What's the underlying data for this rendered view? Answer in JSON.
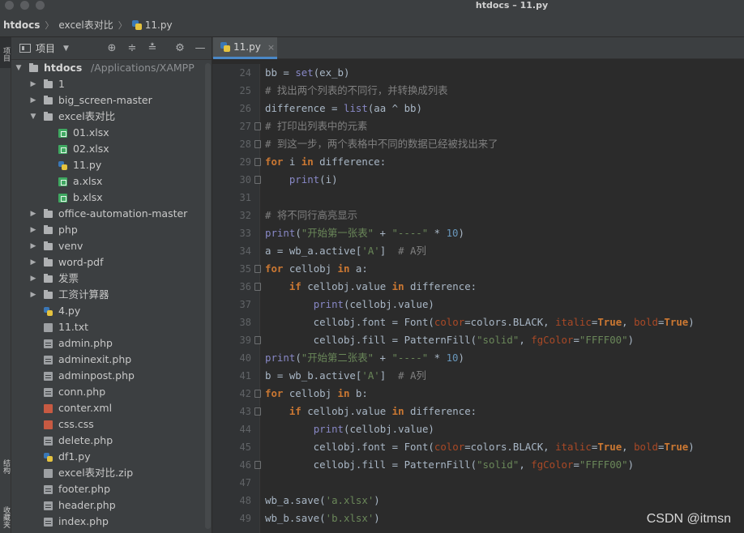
{
  "window": {
    "title": "htdocs – 11.py"
  },
  "breadcrumb": {
    "items": [
      "htdocs",
      "excel表对比",
      "11.py"
    ]
  },
  "stripe": {
    "project_tab": "项目",
    "structure_tab": "结构",
    "favorites_tab": "收藏夹"
  },
  "project": {
    "toolbar_label": "项目",
    "root": {
      "name": "htdocs",
      "path": "/Applications/XAMPP"
    },
    "items": [
      {
        "label": "1",
        "type": "folder",
        "depth": 1,
        "expanded": false
      },
      {
        "label": "big_screen-master",
        "type": "folder",
        "depth": 1,
        "expanded": false
      },
      {
        "label": "excel表对比",
        "type": "folder",
        "depth": 1,
        "expanded": true
      },
      {
        "label": "01.xlsx",
        "type": "xlsx",
        "depth": 2
      },
      {
        "label": "02.xlsx",
        "type": "xlsx",
        "depth": 2
      },
      {
        "label": "11.py",
        "type": "py",
        "depth": 2
      },
      {
        "label": "a.xlsx",
        "type": "xlsx",
        "depth": 2
      },
      {
        "label": "b.xlsx",
        "type": "xlsx",
        "depth": 2
      },
      {
        "label": "office-automation-master",
        "type": "folder",
        "depth": 1,
        "expanded": false
      },
      {
        "label": "php",
        "type": "folder",
        "depth": 1,
        "expanded": false
      },
      {
        "label": "venv",
        "type": "folder",
        "depth": 1,
        "expanded": false
      },
      {
        "label": "word-pdf",
        "type": "folder",
        "depth": 1,
        "expanded": false
      },
      {
        "label": "发票",
        "type": "folder",
        "depth": 1,
        "expanded": false
      },
      {
        "label": "工资计算器",
        "type": "folder",
        "depth": 1,
        "expanded": false
      },
      {
        "label": "4.py",
        "type": "py",
        "depth": 1
      },
      {
        "label": "11.txt",
        "type": "txt",
        "depth": 1
      },
      {
        "label": "admin.php",
        "type": "php",
        "depth": 1
      },
      {
        "label": "adminexit.php",
        "type": "php",
        "depth": 1
      },
      {
        "label": "adminpost.php",
        "type": "php",
        "depth": 1
      },
      {
        "label": "conn.php",
        "type": "php",
        "depth": 1
      },
      {
        "label": "conter.xml",
        "type": "xml",
        "depth": 1
      },
      {
        "label": "css.css",
        "type": "css",
        "depth": 1
      },
      {
        "label": "delete.php",
        "type": "php",
        "depth": 1
      },
      {
        "label": "df1.py",
        "type": "py",
        "depth": 1
      },
      {
        "label": "excel表对比.zip",
        "type": "zip",
        "depth": 1
      },
      {
        "label": "footer.php",
        "type": "php",
        "depth": 1
      },
      {
        "label": "header.php",
        "type": "php",
        "depth": 1
      },
      {
        "label": "index.php",
        "type": "php",
        "depth": 1
      }
    ]
  },
  "editor": {
    "tab_label": "11.py",
    "tab_close": "×",
    "lines": [
      {
        "n": "24",
        "t": [
          [
            "",
            "bb = "
          ],
          [
            "b",
            "set"
          ],
          [
            "",
            "(ex_b)"
          ]
        ]
      },
      {
        "n": "25",
        "t": [
          [
            "c",
            "# 找出两个列表的不同行，并转换成列表"
          ]
        ]
      },
      {
        "n": "26",
        "t": [
          [
            "",
            "difference = "
          ],
          [
            "b",
            "list"
          ],
          [
            "",
            "(aa ^ bb)"
          ]
        ]
      },
      {
        "n": "27",
        "fold": true,
        "t": [
          [
            "c",
            "# 打印出列表中的元素"
          ]
        ]
      },
      {
        "n": "28",
        "fold": true,
        "t": [
          [
            "c",
            "# 到这一步，两个表格中不同的数据已经被找出来了"
          ]
        ]
      },
      {
        "n": "29",
        "fold": true,
        "t": [
          [
            "k",
            "for"
          ],
          [
            "",
            " i "
          ],
          [
            "k",
            "in"
          ],
          [
            "",
            " difference:"
          ]
        ]
      },
      {
        "n": "30",
        "fold": true,
        "t": [
          [
            "",
            "    "
          ],
          [
            "b",
            "print"
          ],
          [
            "",
            "(i)"
          ]
        ]
      },
      {
        "n": "31",
        "t": []
      },
      {
        "n": "32",
        "t": [
          [
            "c",
            "# 将不同行高亮显示"
          ]
        ]
      },
      {
        "n": "33",
        "t": [
          [
            "b",
            "print"
          ],
          [
            "",
            "("
          ],
          [
            "s",
            "\"开始第一张表\""
          ],
          [
            "",
            " + "
          ],
          [
            "s",
            "\"----\""
          ],
          [
            "",
            " * "
          ],
          [
            "n",
            "10"
          ],
          [
            "",
            ")"
          ]
        ]
      },
      {
        "n": "34",
        "t": [
          [
            "",
            "a = wb_a.active["
          ],
          [
            "s",
            "'A'"
          ],
          [
            "",
            "]  "
          ],
          [
            "c",
            "# A列"
          ]
        ]
      },
      {
        "n": "35",
        "fold": true,
        "t": [
          [
            "k",
            "for"
          ],
          [
            "",
            " cellobj "
          ],
          [
            "k",
            "in"
          ],
          [
            "",
            " a:"
          ]
        ]
      },
      {
        "n": "36",
        "fold": true,
        "t": [
          [
            "",
            "    "
          ],
          [
            "k",
            "if"
          ],
          [
            "",
            " cellobj.value "
          ],
          [
            "k",
            "in"
          ],
          [
            "",
            " difference:"
          ]
        ]
      },
      {
        "n": "37",
        "t": [
          [
            "",
            "        "
          ],
          [
            "b",
            "print"
          ],
          [
            "",
            "(cellobj.value)"
          ]
        ]
      },
      {
        "n": "38",
        "t": [
          [
            "",
            "        cellobj.font = Font("
          ],
          [
            "p",
            "color"
          ],
          [
            "",
            "=colors.BLACK, "
          ],
          [
            "p",
            "italic"
          ],
          [
            "",
            "="
          ],
          [
            "k",
            "True"
          ],
          [
            "",
            ", "
          ],
          [
            "p",
            "bold"
          ],
          [
            "",
            "="
          ],
          [
            "k",
            "True"
          ],
          [
            "",
            ")"
          ]
        ]
      },
      {
        "n": "39",
        "fold": true,
        "t": [
          [
            "",
            "        cellobj.fill = PatternFill("
          ],
          [
            "s",
            "\"solid\""
          ],
          [
            "",
            ", "
          ],
          [
            "p",
            "fgColor"
          ],
          [
            "",
            "="
          ],
          [
            "s",
            "\"FFFF00\""
          ],
          [
            "",
            ")"
          ]
        ]
      },
      {
        "n": "40",
        "t": [
          [
            "b",
            "print"
          ],
          [
            "",
            "("
          ],
          [
            "s",
            "\"开始第二张表\""
          ],
          [
            "",
            " + "
          ],
          [
            "s",
            "\"----\""
          ],
          [
            "",
            " * "
          ],
          [
            "n",
            "10"
          ],
          [
            "",
            ")"
          ]
        ]
      },
      {
        "n": "41",
        "t": [
          [
            "",
            "b = wb_b.active["
          ],
          [
            "s",
            "'A'"
          ],
          [
            "",
            "]  "
          ],
          [
            "c",
            "# A列"
          ]
        ]
      },
      {
        "n": "42",
        "fold": true,
        "t": [
          [
            "k",
            "for"
          ],
          [
            "",
            " cellobj "
          ],
          [
            "k",
            "in"
          ],
          [
            "",
            " b:"
          ]
        ]
      },
      {
        "n": "43",
        "fold": true,
        "t": [
          [
            "",
            "    "
          ],
          [
            "k",
            "if"
          ],
          [
            "",
            " cellobj.value "
          ],
          [
            "k",
            "in"
          ],
          [
            "",
            " difference:"
          ]
        ]
      },
      {
        "n": "44",
        "t": [
          [
            "",
            "        "
          ],
          [
            "b",
            "print"
          ],
          [
            "",
            "(cellobj.value)"
          ]
        ]
      },
      {
        "n": "45",
        "t": [
          [
            "",
            "        cellobj.font = Font("
          ],
          [
            "p",
            "color"
          ],
          [
            "",
            "=colors.BLACK, "
          ],
          [
            "p",
            "italic"
          ],
          [
            "",
            "="
          ],
          [
            "k",
            "True"
          ],
          [
            "",
            ", "
          ],
          [
            "p",
            "bold"
          ],
          [
            "",
            "="
          ],
          [
            "k",
            "True"
          ],
          [
            "",
            ")"
          ]
        ]
      },
      {
        "n": "46",
        "fold": true,
        "t": [
          [
            "",
            "        cellobj.fill = PatternFill("
          ],
          [
            "s",
            "\"solid\""
          ],
          [
            "",
            ", "
          ],
          [
            "p",
            "fgColor"
          ],
          [
            "",
            "="
          ],
          [
            "s",
            "\"FFFF00\""
          ],
          [
            "",
            ")"
          ]
        ]
      },
      {
        "n": "47",
        "t": []
      },
      {
        "n": "48",
        "t": [
          [
            "",
            "wb_a.save("
          ],
          [
            "s",
            "'a.xlsx'"
          ],
          [
            "",
            ")"
          ]
        ]
      },
      {
        "n": "49",
        "t": [
          [
            "",
            "wb_b.save("
          ],
          [
            "s",
            "'b.xlsx'"
          ],
          [
            "",
            ")"
          ]
        ]
      }
    ]
  },
  "watermark": "CSDN @itmsn",
  "colors": {
    "accent": "#4a88c7",
    "keyword": "#cc7832",
    "string": "#6a8759",
    "number": "#6897bb",
    "comment": "#808080",
    "builtin": "#8888c6",
    "param": "#aa4926"
  },
  "icons": [
    "target-icon",
    "collapse-all-icon",
    "expand-all-icon",
    "gear-icon",
    "minimize-icon",
    "chevron-down-icon"
  ]
}
